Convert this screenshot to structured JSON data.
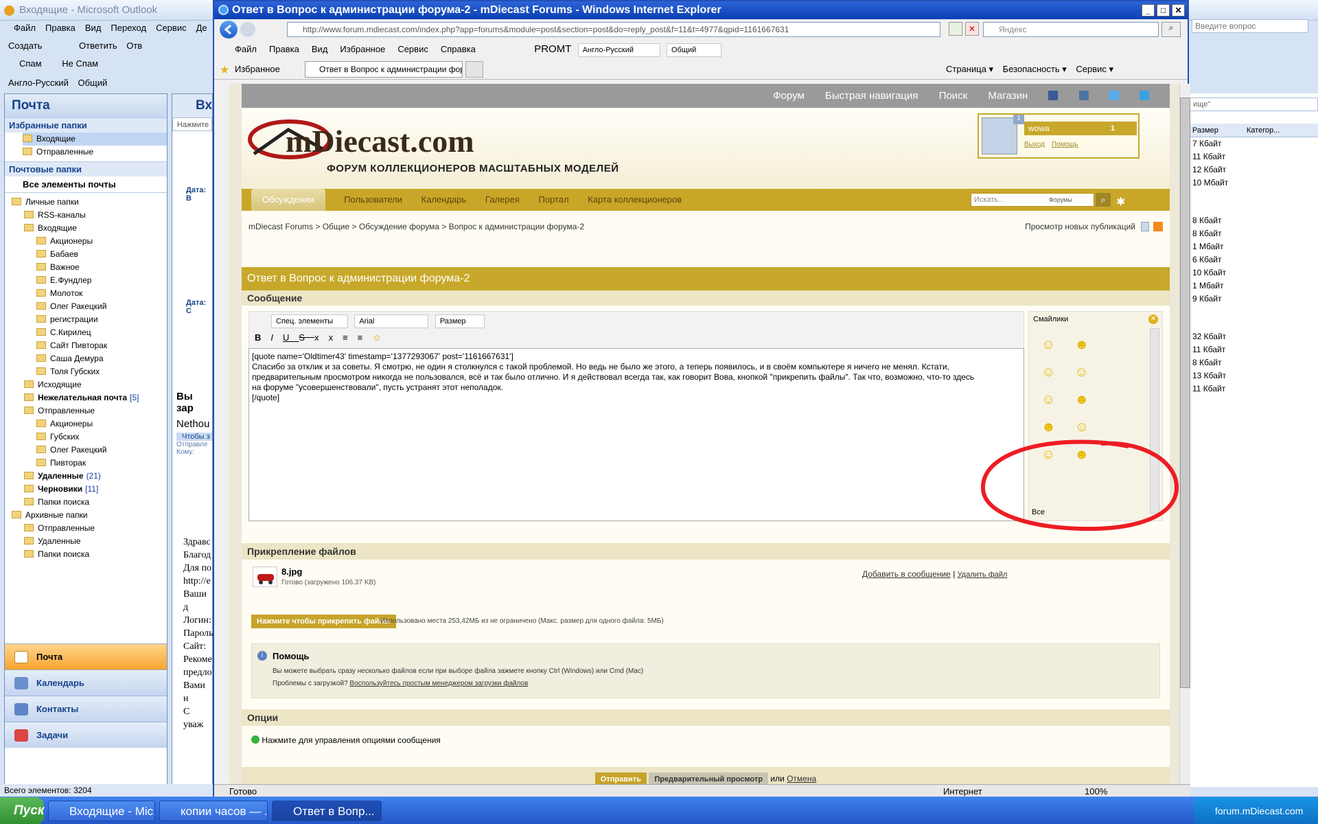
{
  "outlook": {
    "title": "Входящие - Microsoft Outlook",
    "menu": [
      "Файл",
      "Правка",
      "Вид",
      "Переход",
      "Сервис",
      "Де"
    ],
    "toolbar1": [
      "Создать",
      "Ответить",
      "Отв"
    ],
    "toolbar2": [
      "Спам",
      "Не Спам"
    ],
    "toolbar3": [
      "Англо-Русский",
      "Общий"
    ],
    "question_placeholder": "Введите вопрос",
    "search_placeholder": "ище\"",
    "nav_title": "Почта",
    "favorites_header": "Избранные папки",
    "favorites": [
      "Входящие",
      "Отправленные"
    ],
    "mail_header": "Почтовые папки",
    "all_items": "Все элементы почты",
    "tree": [
      {
        "label": "Личные папки",
        "indent": 0
      },
      {
        "label": "RSS-каналы",
        "indent": 1
      },
      {
        "label": "Входящие",
        "indent": 1
      },
      {
        "label": "Акционеры",
        "indent": 2
      },
      {
        "label": "Бабаев",
        "indent": 2
      },
      {
        "label": "Важное",
        "indent": 2
      },
      {
        "label": "Е.Фундлер",
        "indent": 2
      },
      {
        "label": "Молоток",
        "indent": 2
      },
      {
        "label": "Олег Ракецкий",
        "indent": 2
      },
      {
        "label": "регистрации",
        "indent": 2
      },
      {
        "label": "С.Кирилец",
        "indent": 2
      },
      {
        "label": "Сайт Пивторак",
        "indent": 2
      },
      {
        "label": "Саша Демура",
        "indent": 2
      },
      {
        "label": "Толя Губских",
        "indent": 2
      },
      {
        "label": "Исходящие",
        "indent": 1
      },
      {
        "label": "Нежелательная почта",
        "count": "[5]",
        "indent": 1,
        "bold": true
      },
      {
        "label": "Отправленные",
        "indent": 1
      },
      {
        "label": "Акционеры",
        "indent": 2
      },
      {
        "label": "Губских",
        "indent": 2
      },
      {
        "label": "Олег Ракецкий",
        "indent": 2
      },
      {
        "label": "Пивторак",
        "indent": 2
      },
      {
        "label": "Удаленные",
        "count": "(21)",
        "indent": 1,
        "bold": true
      },
      {
        "label": "Черновики",
        "count": "[11]",
        "indent": 1,
        "bold": true
      },
      {
        "label": "Папки поиска",
        "indent": 1
      },
      {
        "label": "Архивные папки",
        "indent": 0
      },
      {
        "label": "Отправленные",
        "indent": 1
      },
      {
        "label": "Удаленные",
        "indent": 1
      },
      {
        "label": "Папки поиска",
        "indent": 1
      }
    ],
    "nav_buttons": [
      "Почта",
      "Календарь",
      "Контакты",
      "Задачи"
    ],
    "status": "Всего элементов: 3204",
    "mid_header": "Вх",
    "mid_search": "Нажмите",
    "mid_groups": [
      "Дата: В",
      "Дата: С"
    ],
    "mid_preview": {
      "subject": "Вы зар",
      "from": "Nethou",
      "info": "Чтобы з",
      "sent": "Отправле",
      "to": "Кому:"
    },
    "mid_body": [
      "Здравс",
      "Благод",
      "Для по",
      "http://e",
      "Ваши д",
      "Логин:",
      "Пароль",
      "Сайт:",
      "Рекоме",
      "предло",
      "Вами н",
      "С уваж"
    ],
    "right_cols": [
      "Размер",
      "Категор..."
    ],
    "sizes": [
      "7 Кбайт",
      "11 Кбайт",
      "12 Кбайт",
      "10 Мбайт",
      "8 Кбайт",
      "8 Кбайт",
      "1 Мбайт",
      "6 Кбайт",
      "10 Кбайт",
      "1 Мбайт",
      "9 Кбайт",
      "32 Кбайт",
      "11 Кбайт",
      "8 Кбайт",
      "13 Кбайт",
      "11 Кбайт"
    ]
  },
  "ie": {
    "title": "Ответ в Вопрос к администрации форума-2 - mDiecast Forums - Windows Internet Explorer",
    "url": "http://www.forum.mdiecast.com/index.php?app=forums&module=post&section=post&do=reply_post&f=11&t=4977&qpid=1161667631",
    "search_placeholder": "Яндекс",
    "menu": [
      "Файл",
      "Правка",
      "Вид",
      "Избранное",
      "Сервис",
      "Справка"
    ],
    "promt": "PROMT",
    "promt_dir": "Англо-Русский",
    "promt_topic": "Общий",
    "favorites": "Избранное",
    "tab": "Ответ в Вопрос к администрации форума-2...",
    "cmd": [
      "Страница",
      "Безопасность",
      "Сервис"
    ],
    "status": "Готово",
    "zone": "Интернет",
    "zoom": "100%"
  },
  "forum": {
    "topnav": [
      "Форум",
      "Быстрая навигация",
      "Поиск",
      "Магазин"
    ],
    "logo": "mDiecast.com",
    "logo_sub": "ФОРУМ КОЛЛЕКЦИОНЕРОВ МАСШТАБНЫХ МОДЕЛЕЙ",
    "user": "wowa",
    "user_count": "1",
    "notif_count": "1",
    "logout": "Выход",
    "help": "Помощь",
    "tabs": [
      "Обсуждения",
      "Пользователи",
      "Календарь",
      "Галерея",
      "Портал",
      "Карта коллекционеров"
    ],
    "search_placeholder": "Искать...",
    "search_scope": "Форумы",
    "breadcrumb": [
      "mDiecast Forums",
      "Общие",
      "Обсуждение форума",
      "Вопрос к администрации форума-2"
    ],
    "new_posts": "Просмотр новых публикаций",
    "page_title": "Ответ в Вопрос к администрации форума-2",
    "message_label": "Сообщение",
    "editor": {
      "special": "Спец. элементы",
      "font": "Arial",
      "size": "Размер"
    },
    "editor_text": "[quote name='Oldtimer43' timestamp='1377293067' post='1161667631']\nСпасибо за отклик и за советы. Я смотрю, не один я столкнулся с такой проблемой. Но ведь не было же этого, а теперь появилось, и в своём компьютере я ничего не менял. Кстати,\nпредварительным просмотром никогда не пользовался, всё и так было отлично. И я действовал всегда так, как говорит Вова, кнопкой \"прикрепить файлы\". Так что, возможно, что-то здесь\nна форуме \"усовершенствовали\", пусть устранят этот неполадок.\n[/quote]",
    "smilies_title": "Смайлики",
    "smilies_all": "Все",
    "attach_label": "Прикрепление файлов",
    "file_name": "8.jpg",
    "file_status": "Готово (загружено 106.37 KB)",
    "add_to_post": "Добавить в сообщение",
    "delete_file": "Удалить файл",
    "attach_btn": "Нажмите чтобы прикрепить файлы",
    "space_used": "Использовано места 253,42МБ из не ограничено (Макс. размер для одного файла: 5МБ)",
    "help_title": "Помощь",
    "help_line1": "Вы можете выбрать сразу несколько файлов если при выборе файла зажмете кнопку Ctrl (Windows) или Cmd (Mac)",
    "help_line2": "Проблемы с загрузкой?",
    "help_link": "Воспользуйтесь простым менеджером загрузки файлов",
    "options_label": "Опции",
    "options_toggle": "Нажмите для управления опциями сообщения",
    "submit": "Отправить",
    "preview": "Предварительный просмотр",
    "or": "или",
    "cancel": "Отмена"
  },
  "taskbar": {
    "start": "Пуск",
    "items": [
      "Входящие - Mic...",
      "копии часов — ...",
      "Ответ в Вопр..."
    ],
    "tray": "forum.mDiecast.com"
  },
  "colors": {
    "accent_gold": "#c8a82a",
    "annotation": "#ee1c24",
    "xp_blue": "#2458c8"
  }
}
